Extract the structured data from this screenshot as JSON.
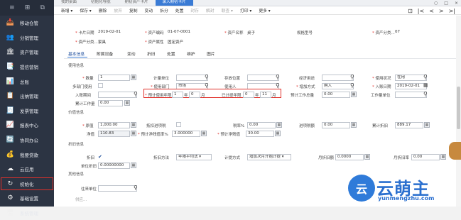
{
  "sidebar": {
    "top_icons": [
      "≡",
      "⊞",
      "⧉"
    ],
    "items": [
      {
        "icon": "📥",
        "label": "移动仓管"
      },
      {
        "icon": "👥",
        "label": "分销管理"
      },
      {
        "icon": "🏛",
        "label": "资产管理"
      },
      {
        "icon": "📑",
        "label": "提信营销"
      },
      {
        "icon": "📊",
        "label": "总账"
      },
      {
        "icon": "📋",
        "label": "出纳管理"
      },
      {
        "icon": "🧾",
        "label": "发票管理"
      },
      {
        "icon": "📈",
        "label": "报表中心"
      },
      {
        "icon": "🔄",
        "label": "协同办公"
      },
      {
        "icon": "💰",
        "label": "我要贷款"
      },
      {
        "icon": "☁",
        "label": "云应用"
      },
      {
        "icon": "↻",
        "label": "初始化"
      },
      {
        "icon": "⚙",
        "label": "基础设置"
      },
      {
        "icon": "🖥",
        "label": "系统管理"
      }
    ]
  },
  "tabs": [
    "我的桌面",
    "初始化导航",
    "期初资产卡片",
    "录入期初卡片"
  ],
  "window_controls": [
    "○",
    "□",
    "×"
  ],
  "toolbar": {
    "items": [
      "新增 ▾",
      "保存 ▾",
      "删除",
      "放弃",
      "复制",
      "变动",
      "拆分",
      "处置",
      "封存",
      "解封",
      "联查 ▾",
      "打印 ▾",
      "更多 ▾"
    ],
    "disabled": [
      3,
      8,
      9,
      10
    ],
    "right": [
      "⊡",
      "|<",
      "<",
      ">",
      ">|"
    ]
  },
  "header": {
    "card_date_label": "卡片日期",
    "card_date": "2019-02-01",
    "asset_code_label": "资产编码",
    "asset_code": "01-07-0001",
    "asset_name_label": "资产名称",
    "asset_name": "桌子",
    "spec_label": "规格型号",
    "asset_class_label": "资产分类...",
    "asset_class_code": "07",
    "asset_class2_label": "资产分类...",
    "asset_class_name": "家具",
    "asset_attr_label": "资产属性",
    "asset_attr": "固定资产"
  },
  "form_tabs": [
    "基本信息",
    "附属设备",
    "变动",
    "折旧",
    "处置",
    "维护",
    "图片"
  ],
  "sections": {
    "usage": "使用信息",
    "value": "价值信息",
    "depr": "折旧信息",
    "other": "其他信息"
  },
  "usage": {
    "qty_label": "数量",
    "qty": "1",
    "unit_label": "计量单位",
    "location_label": "存放位置",
    "economic_use_label": "经济用途",
    "status_label": "使用状况",
    "status": "在用",
    "multi_dept_label": "多部门使用",
    "dept_label": "使用部门",
    "dept": "市场",
    "user_label": "使用人",
    "add_method_label": "增加方式",
    "add_method": "购入",
    "entry_date_label": "入账日期",
    "entry_date": "2019-02-01",
    "entry_no_label": "入账期间",
    "used_years_label": "预计使用年限",
    "used_years": "1",
    "used_months": "0",
    "year_unit": "年",
    "month_unit": "月",
    "depr_years_label": "已计提年限",
    "depr_years": "0",
    "depr_months": "11",
    "workload_label": "预计工作总量",
    "workload": "0.00",
    "work_unit_label": "工作量单位",
    "accum_work_label": "累计工作量",
    "accum_work": "0.00"
  },
  "value": {
    "orig_label": "原值",
    "orig": "1,000.00",
    "offset_label": "抵扣进项税",
    "tax_rate_label": "税率%",
    "tax_rate": "0.00",
    "input_tax_label": "进项税额",
    "input_tax": "0.00",
    "accum_depr_label": "累计折旧",
    "accum_depr": "889.17",
    "net_label": "净值",
    "net": "110.83",
    "resid_rate_label": "预计净残值率%",
    "resid_rate": "3.000000",
    "resid_label": "预计净残值",
    "resid": "30.00"
  },
  "depr": {
    "depr_label": "折旧",
    "depr_checked": "✔",
    "method_label": "折旧方法",
    "method": "年限平均法",
    "calc_label": "计提方式",
    "calc": "增加次月开始计提",
    "monthly_amt_label": "月折旧额",
    "monthly_amt": "0.0000",
    "monthly_rate_label": "月折旧率",
    "monthly_rate": "0.00",
    "unit_depr_label": "单位折旧",
    "unit_depr": "0.00000000"
  },
  "other": {
    "partner_label": "往来单位",
    "next_label": "供应..."
  },
  "watermark": {
    "logo": "云",
    "name": "云萌主",
    "url": "yunmengzhu.com"
  }
}
